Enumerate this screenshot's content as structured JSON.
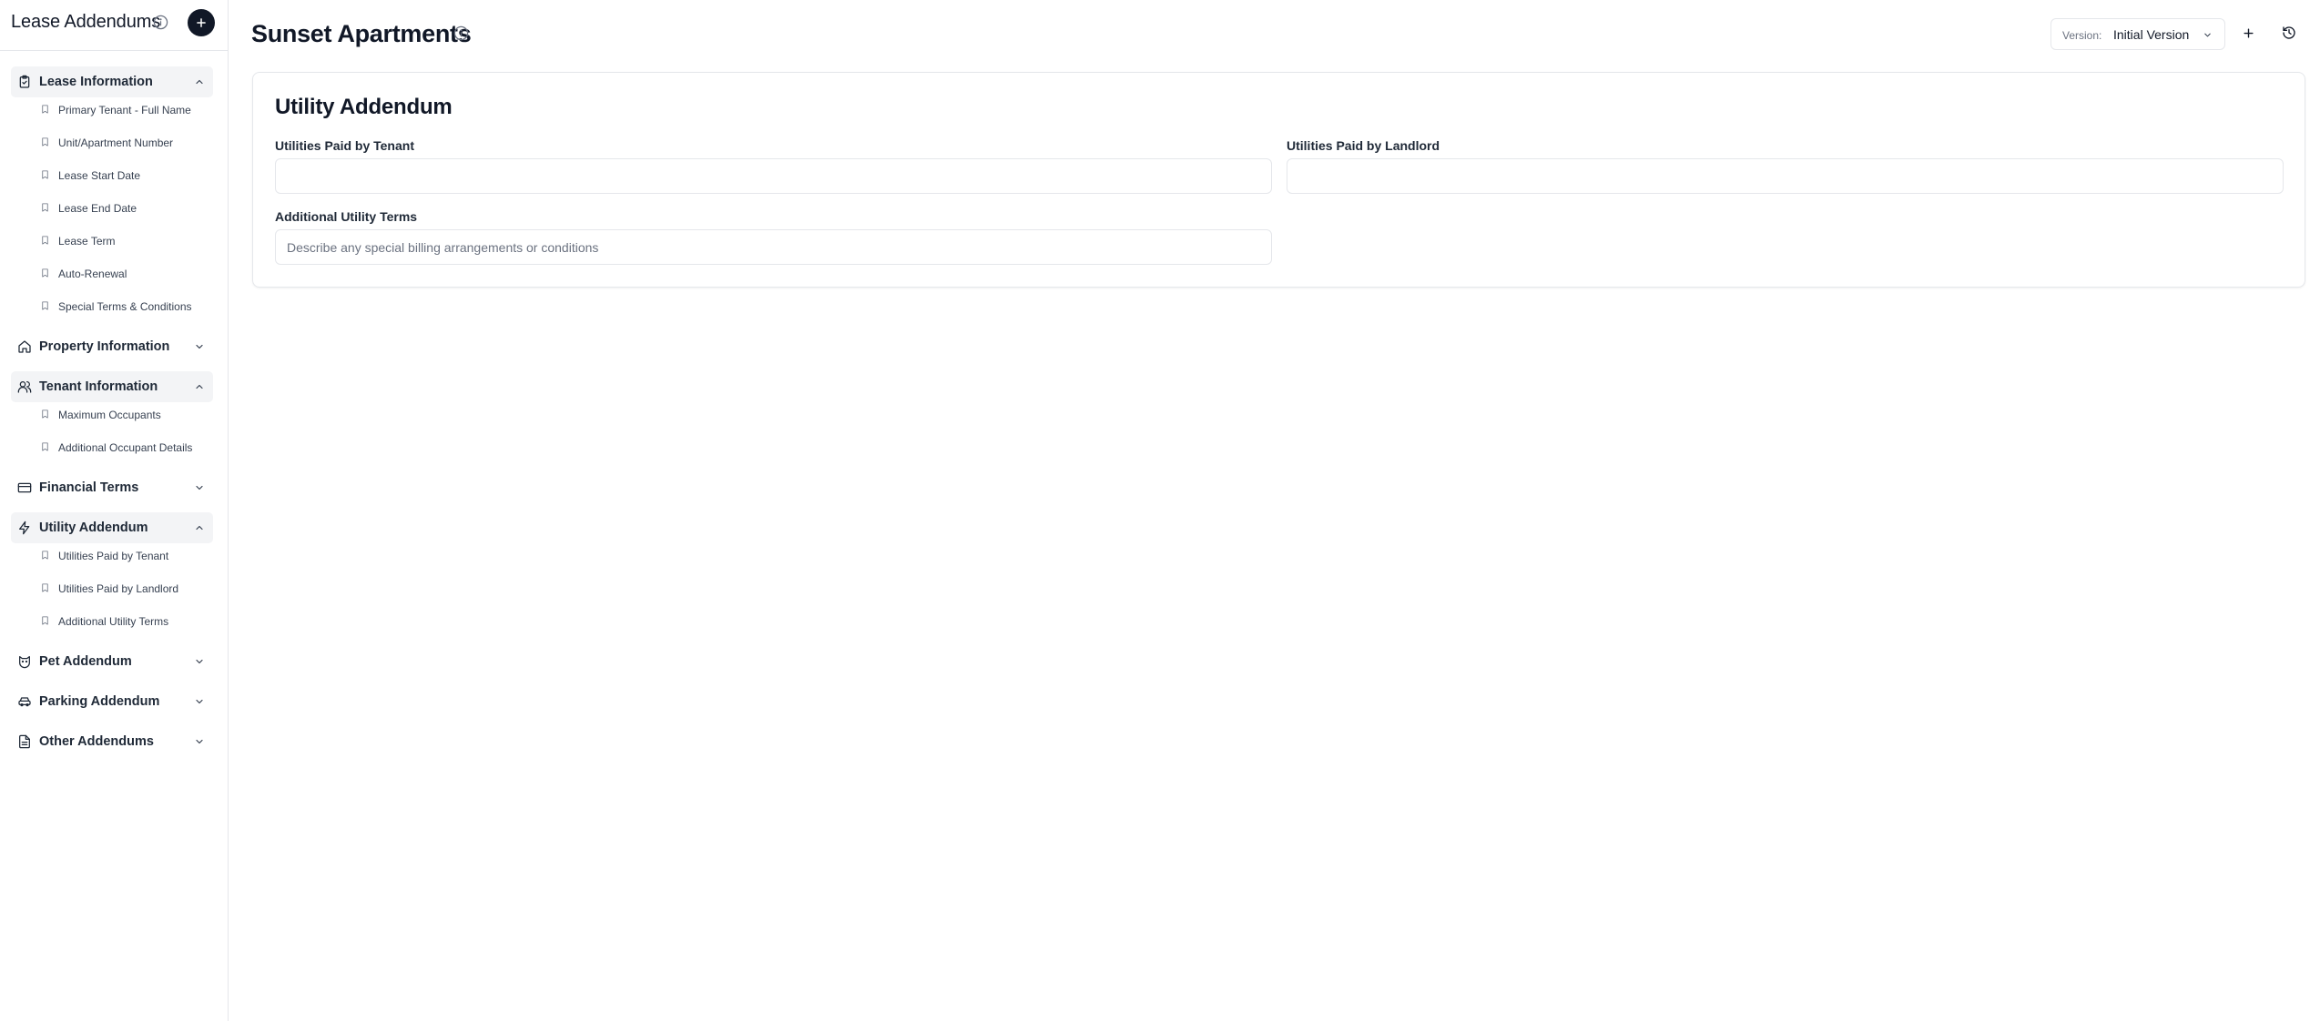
{
  "sidebar": {
    "title": "Lease Addendums",
    "sections": [
      {
        "label": "Lease Information",
        "icon": "clipboard-icon",
        "expanded": true,
        "items": [
          "Primary Tenant - Full Name",
          "Unit/Apartment Number",
          "Lease Start Date",
          "Lease End Date",
          "Lease Term",
          "Auto-Renewal",
          "Special Terms & Conditions"
        ]
      },
      {
        "label": "Property Information",
        "icon": "house-icon",
        "expanded": false,
        "items": []
      },
      {
        "label": "Tenant Information",
        "icon": "users-icon",
        "expanded": true,
        "items": [
          "Maximum Occupants",
          "Additional Occupant Details"
        ]
      },
      {
        "label": "Financial Terms",
        "icon": "credit-card-icon",
        "expanded": false,
        "items": []
      },
      {
        "label": "Utility Addendum",
        "icon": "plug-icon",
        "expanded": true,
        "items": [
          "Utilities Paid by Tenant",
          "Utilities Paid by Landlord",
          "Additional Utility Terms"
        ]
      },
      {
        "label": "Pet Addendum",
        "icon": "cat-icon",
        "expanded": false,
        "items": []
      },
      {
        "label": "Parking Addendum",
        "icon": "car-icon",
        "expanded": false,
        "items": []
      },
      {
        "label": "Other Addendums",
        "icon": "document-icon",
        "expanded": false,
        "items": []
      }
    ]
  },
  "header": {
    "title": "Sunset Apartments",
    "version_label": "Version:",
    "version_value": "Initial Version"
  },
  "form": {
    "title": "Utility Addendum",
    "tenant_label": "Utilities Paid by Tenant",
    "tenant_value": "",
    "landlord_label": "Utilities Paid by Landlord",
    "landlord_value": "",
    "terms_label": "Additional Utility Terms",
    "terms_placeholder": "Describe any special billing arrangements or conditions"
  },
  "colors": {
    "accent": "#111827",
    "border": "#e5e7eb",
    "muted_text": "#6b7280",
    "section_bg": "#f3f4f6"
  }
}
